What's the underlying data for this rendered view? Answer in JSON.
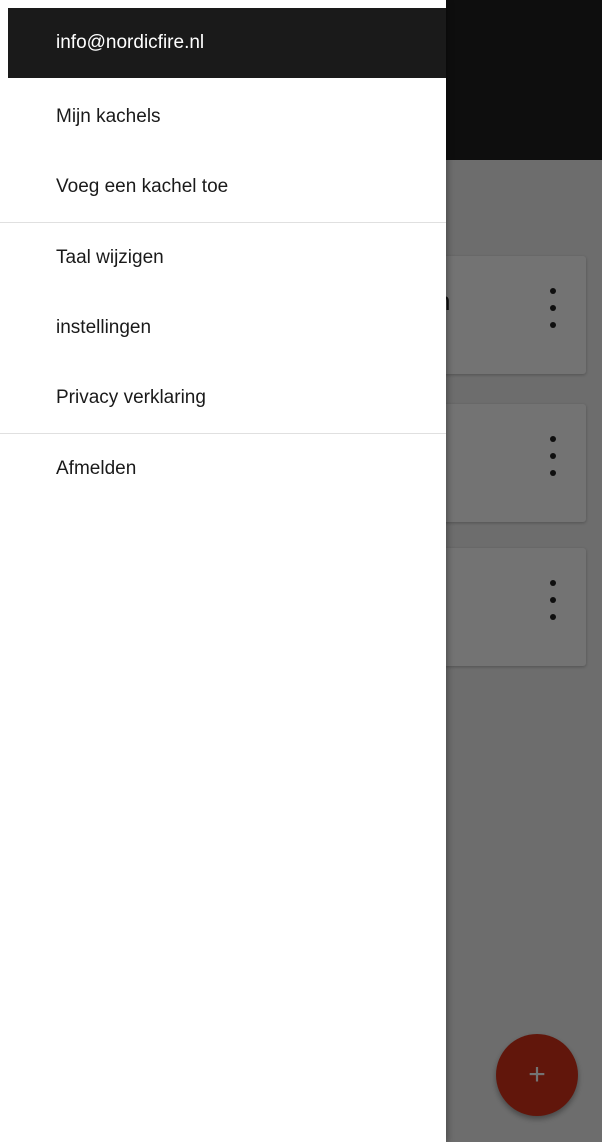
{
  "drawer": {
    "account_email": "info@nordicfire.nl",
    "items": [
      {
        "label": "Mijn kachels"
      },
      {
        "label": "Voeg een kachel toe"
      },
      {
        "label": "Taal wijzigen"
      },
      {
        "label": "instellingen"
      },
      {
        "label": "Privacy verklaring"
      },
      {
        "label": "Afmelden"
      }
    ]
  },
  "background": {
    "cards": [
      {
        "title": "n",
        "menu_icon": "more-vertical-icon"
      },
      {
        "title": "",
        "menu_icon": "more-vertical-icon"
      },
      {
        "title": "",
        "menu_icon": "more-vertical-icon"
      }
    ],
    "fab": {
      "label": "+",
      "icon": "add-icon"
    }
  },
  "colors": {
    "toolbar": "#1f1f1f",
    "drawer_header": "#1a1a1a",
    "fab": "#d8321a",
    "scrim": "rgba(0,0,0,0.55)"
  }
}
